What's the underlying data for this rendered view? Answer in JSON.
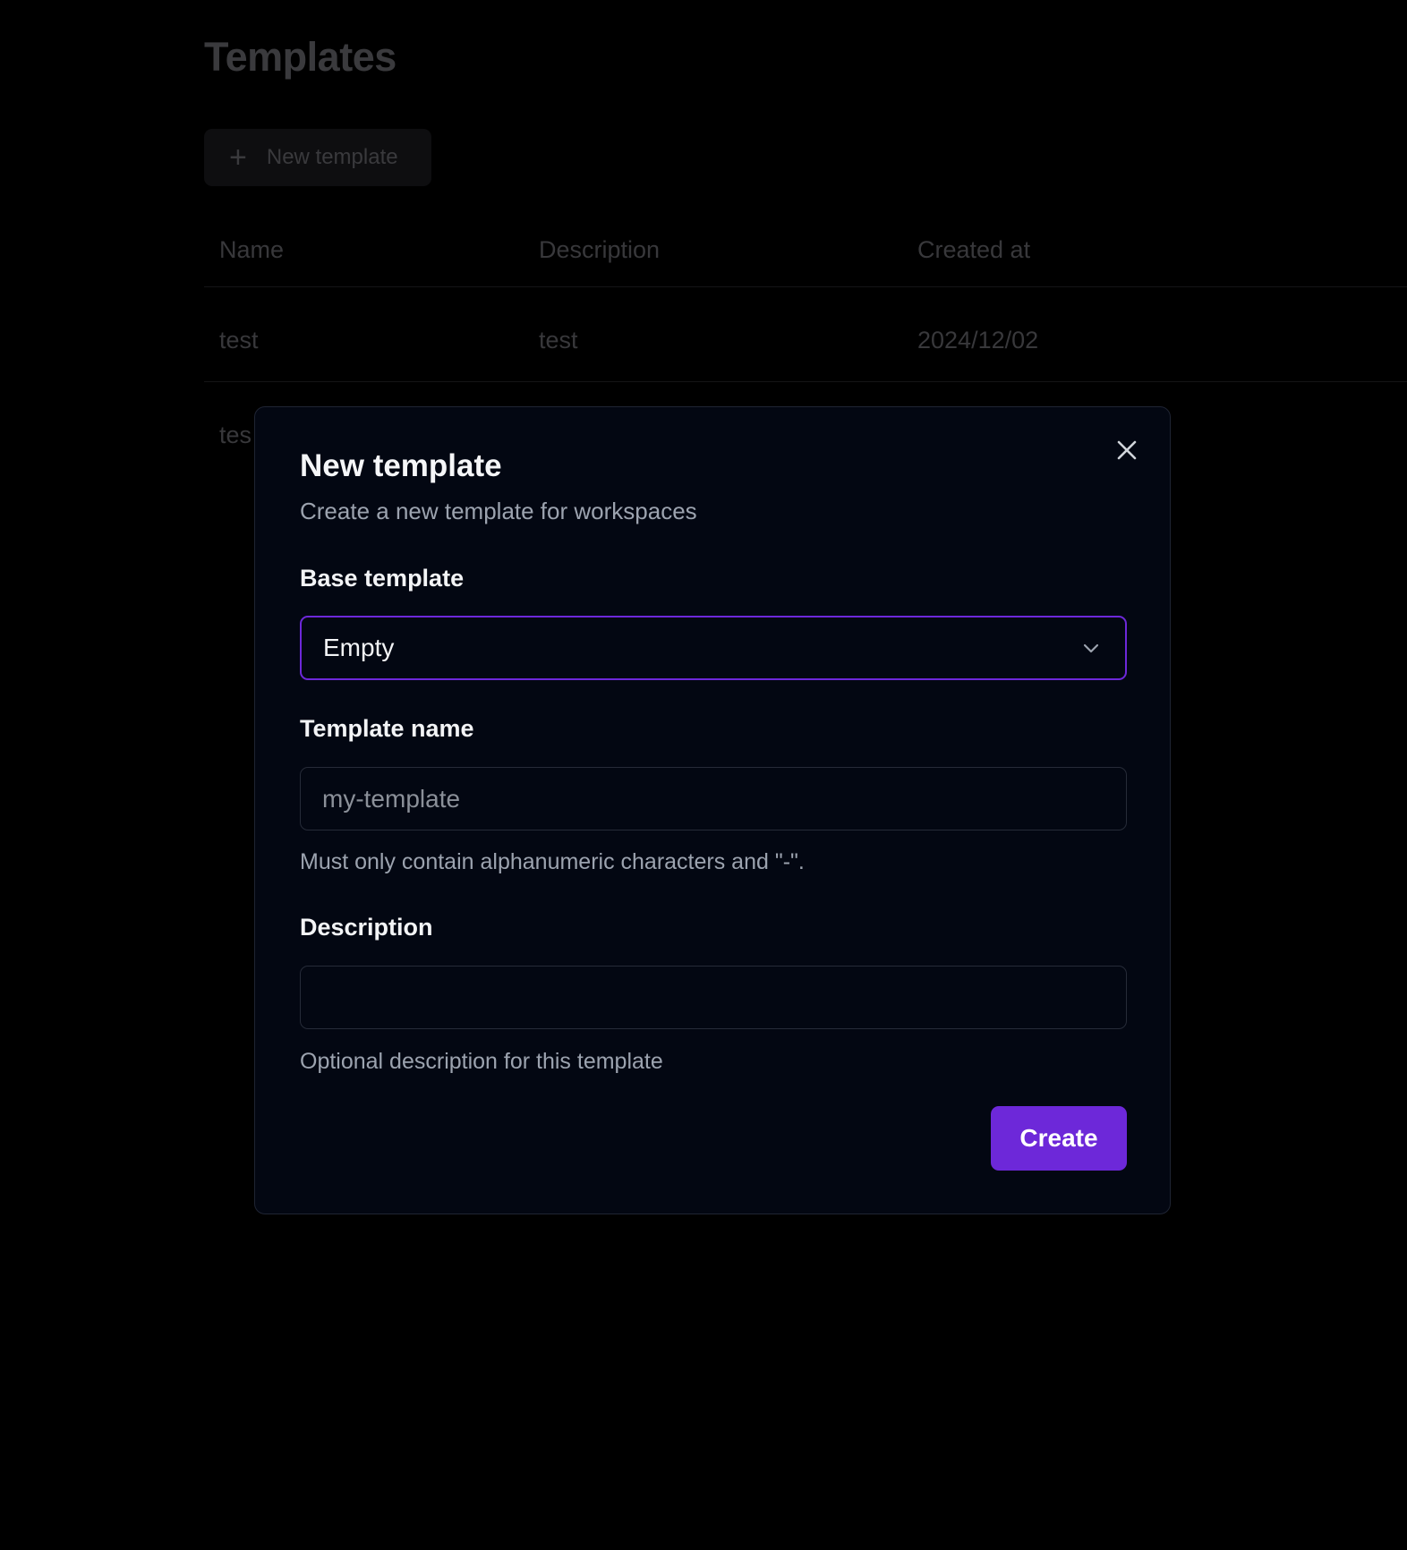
{
  "background": {
    "page_title": "Templates",
    "new_template_button": "New template",
    "table": {
      "headers": [
        "Name",
        "Description",
        "Created at"
      ],
      "rows": [
        {
          "name": "test",
          "description": "test",
          "created_at": "2024/12/02"
        },
        {
          "name": "tes",
          "description": "",
          "created_at": ""
        }
      ]
    }
  },
  "modal": {
    "title": "New template",
    "subtitle": "Create a new template for workspaces",
    "base_template": {
      "label": "Base template",
      "selected": "Empty"
    },
    "template_name": {
      "label": "Template name",
      "value": "",
      "placeholder": "my-template",
      "hint": "Must only contain alphanumeric characters and \"-\"."
    },
    "description": {
      "label": "Description",
      "value": "",
      "placeholder": "",
      "hint": "Optional description for this template"
    },
    "create_button": "Create"
  },
  "colors": {
    "accent": "#6d28d9",
    "modal_bg": "#030712",
    "page_bg": "#000000"
  },
  "icons": {
    "close": "close-icon",
    "chevron": "chevron-down-icon",
    "plus": "plus-icon"
  }
}
